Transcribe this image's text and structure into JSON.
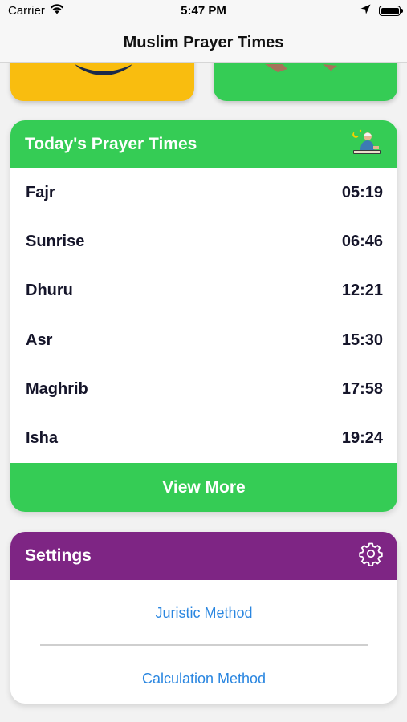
{
  "status_bar": {
    "carrier": "Carrier",
    "time": "5:47 PM"
  },
  "nav": {
    "title": "Muslim Prayer Times"
  },
  "prayer_card": {
    "title": "Today's Prayer Times",
    "rows": [
      {
        "name": "Fajr",
        "time": "05:19"
      },
      {
        "name": "Sunrise",
        "time": "06:46"
      },
      {
        "name": "Dhuru",
        "time": "12:21"
      },
      {
        "name": "Asr",
        "time": "15:30"
      },
      {
        "name": "Maghrib",
        "time": "17:58"
      },
      {
        "name": "Isha",
        "time": "19:24"
      }
    ],
    "button_label": "View More"
  },
  "settings_card": {
    "title": "Settings",
    "links": {
      "juristic": "Juristic Method",
      "calculation": "Calculation Method"
    }
  },
  "colors": {
    "green": "#35cc55",
    "yellow": "#f9bd0f",
    "purple": "#7e2584",
    "link": "#2a86e0"
  }
}
